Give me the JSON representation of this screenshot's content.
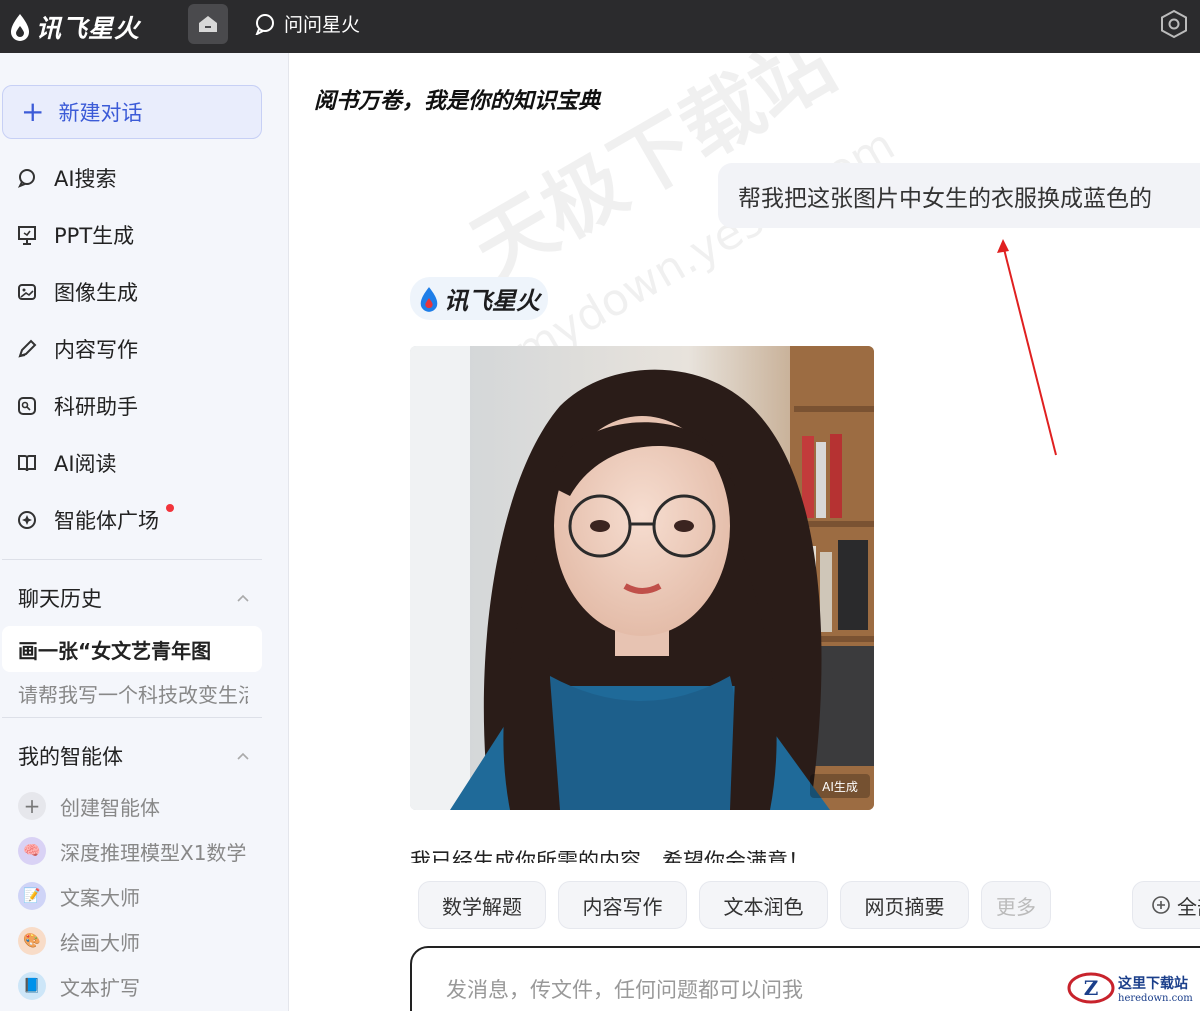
{
  "topbar": {
    "brand": "讯飞星火",
    "tab_label": "问问星火"
  },
  "sidebar": {
    "new_chat": "新建对话",
    "nav": [
      {
        "label": "AI搜索"
      },
      {
        "label": "PPT生成"
      },
      {
        "label": "图像生成"
      },
      {
        "label": "内容写作"
      },
      {
        "label": "科研助手"
      },
      {
        "label": "AI阅读"
      },
      {
        "label": "智能体广场"
      }
    ],
    "history_title": "聊天历史",
    "history": [
      "画一张“女文艺青年图",
      "请帮我写一个科技改变生活"
    ],
    "agents_title": "我的智能体",
    "agents": [
      {
        "label": "创建智能体",
        "color": "#e6e7ec"
      },
      {
        "label": "深度推理模型X1数学",
        "color": "#d9d2f5"
      },
      {
        "label": "文案大师",
        "color": "#cfd4f7"
      },
      {
        "label": "绘画大师",
        "color": "#f8dcc8"
      },
      {
        "label": "文本扩写",
        "color": "#cde6f8"
      }
    ]
  },
  "main": {
    "title": "阅书万卷，我是你的知识宝典",
    "user_message": "帮我把这张图片中女生的衣服换成蓝色的",
    "bot_name": "讯飞星火",
    "reply": "我已经生成你所需的内容，希望你会满意！",
    "image_tag": "AI生成",
    "chips": [
      "数学解题",
      "内容写作",
      "文本润色",
      "网页摘要",
      "更多"
    ],
    "full_chip": "全部",
    "composer_placeholder": "发消息，传文件，任何问题都可以问我"
  },
  "watermarks": {
    "main": "天极下载站",
    "sub": "mydown.yesky.com",
    "corner_title": "这里下载站",
    "corner_url": "heredown.com"
  },
  "colors": {
    "accent": "#3c5bd7",
    "topbar": "#2b2b2d",
    "annotation_arrow": "#e02020"
  }
}
